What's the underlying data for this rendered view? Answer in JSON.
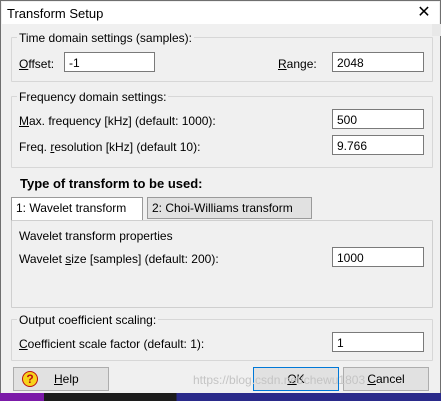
{
  "window": {
    "title": "Transform Setup",
    "close_glyph": "✕"
  },
  "time_domain": {
    "group_title": "Time domain settings (samples):",
    "offset_label": "Offset:",
    "offset_value": "-1",
    "range_label": "Range:",
    "range_value": "2048"
  },
  "frequency_domain": {
    "group_title": "Frequency domain settings:",
    "max_freq_label": "Max. frequency [kHz] (default: 1000):",
    "max_freq_value": "500",
    "freq_res_label": "Freq. resolution [kHz] (default 10):",
    "freq_res_value": "9.766"
  },
  "transform_type": {
    "heading": "Type of transform to be used:",
    "tabs": [
      {
        "label": "1: Wavelet transform",
        "active": true
      },
      {
        "label": "2: Choi-Williams transform",
        "active": false
      }
    ]
  },
  "wavelet": {
    "group_title": "Wavelet transform properties",
    "size_label": "Wavelet size [samples] (default: 200):",
    "size_value": "1000"
  },
  "scaling": {
    "group_title": "Output coefficient scaling:",
    "factor_label": "Coefficient scale factor (default: 1):",
    "factor_value": "1"
  },
  "buttons": {
    "help": "Help",
    "help_icon": "question-icon",
    "ok": "OK",
    "cancel": "Cancel"
  },
  "watermark": "https://blog.csdn.net/chewu1803"
}
